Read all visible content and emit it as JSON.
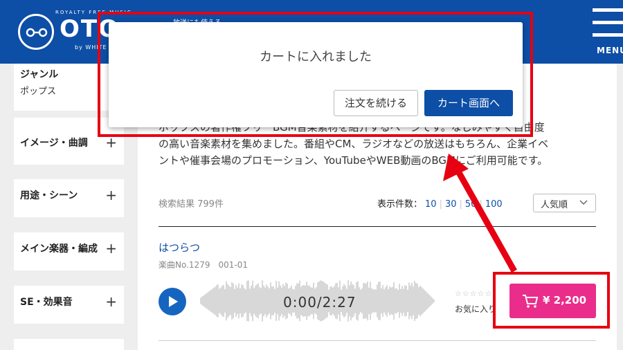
{
  "header": {
    "logo_small": "ROYALTY FREE MUSIC",
    "logo_text": "OTO",
    "logo_by": "by WHITE",
    "tagline": "放送にも使える",
    "menu_label": "MENU"
  },
  "sidebar": {
    "items": [
      {
        "title": "ジャンル",
        "sub": "ポップス"
      },
      {
        "title": "イメージ・曲調",
        "plus": "+"
      },
      {
        "title": "用途・シーン",
        "plus": "+"
      },
      {
        "title": "メイン楽器・編成",
        "plus": "+"
      },
      {
        "title": "SE・効果音",
        "plus": "+"
      }
    ]
  },
  "main": {
    "description_line1": "ポップスの著作権フリーBGM音楽素材を紹介するページです。なじみやすく自由度",
    "description_line2": "の高い音楽素材を集めました。番組やCM、ラジオなどの放送はもちろん、企業イベ",
    "description_line3": "ントや催事会場のプロモーション、YouTubeやWEB動画のBGMにご利用可能です。",
    "results": "検索結果 799件",
    "perpage_label": "表示件数：",
    "perpage_options": [
      "10",
      "30",
      "50",
      "100"
    ],
    "sort_value": "人気順",
    "track": {
      "title": "はつらつ",
      "number": "楽曲No.1279　001-01",
      "time": "0:00/2:27",
      "stars": "☆☆☆☆☆",
      "favorite": "お気に入り",
      "price": "¥ 2,200"
    }
  },
  "modal": {
    "message": "カートに入れました",
    "continue_label": "注文を続ける",
    "cart_label": "カート画面へ"
  },
  "colors": {
    "brand_blue": "#0d4ea6",
    "cart_pink": "#ea2d8b",
    "annotation_red": "#e60012"
  }
}
